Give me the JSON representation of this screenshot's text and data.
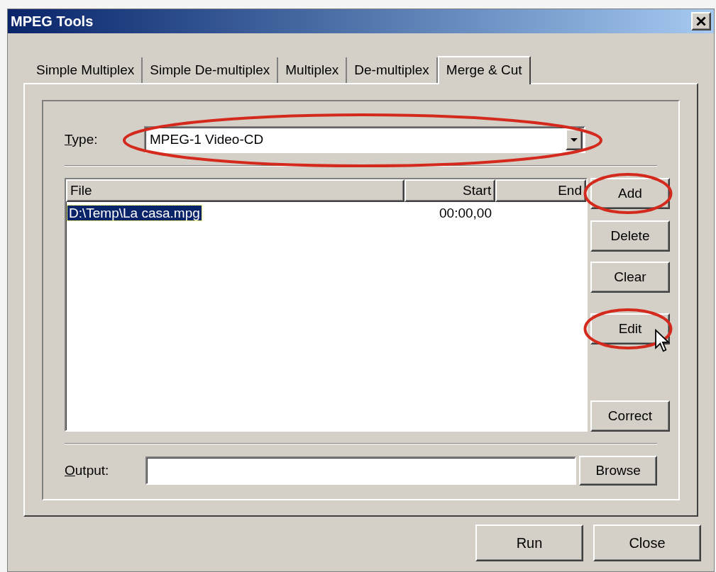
{
  "window": {
    "title": "MPEG Tools"
  },
  "tabs": [
    {
      "label": "Simple Multiplex",
      "selected": false
    },
    {
      "label": "Simple De-multiplex",
      "selected": false
    },
    {
      "label": "Multiplex",
      "selected": false
    },
    {
      "label": "De-multiplex",
      "selected": false
    },
    {
      "label": "Merge & Cut",
      "selected": true
    }
  ],
  "type_field": {
    "label": "Type:",
    "value": "MPEG-1 Video-CD",
    "highlighted": true
  },
  "file_list": {
    "columns": [
      "File",
      "Start",
      "End"
    ],
    "rows": [
      {
        "file": "D:\\Temp\\La casa.mpg",
        "start": "00:00,00",
        "selected": true
      }
    ]
  },
  "side_buttons": [
    {
      "label": "Add",
      "highlighted": true,
      "pointer": false
    },
    {
      "label": "Delete",
      "highlighted": false,
      "pointer": false
    },
    {
      "label": "Clear",
      "highlighted": false,
      "pointer": false
    },
    {
      "label": "Edit",
      "highlighted": true,
      "pointer": true
    },
    {
      "label": "Correct",
      "highlighted": false,
      "pointer": false
    }
  ],
  "output": {
    "label": "Output:",
    "button": "Browse"
  },
  "footer_buttons": [
    "Run",
    "Close"
  ]
}
